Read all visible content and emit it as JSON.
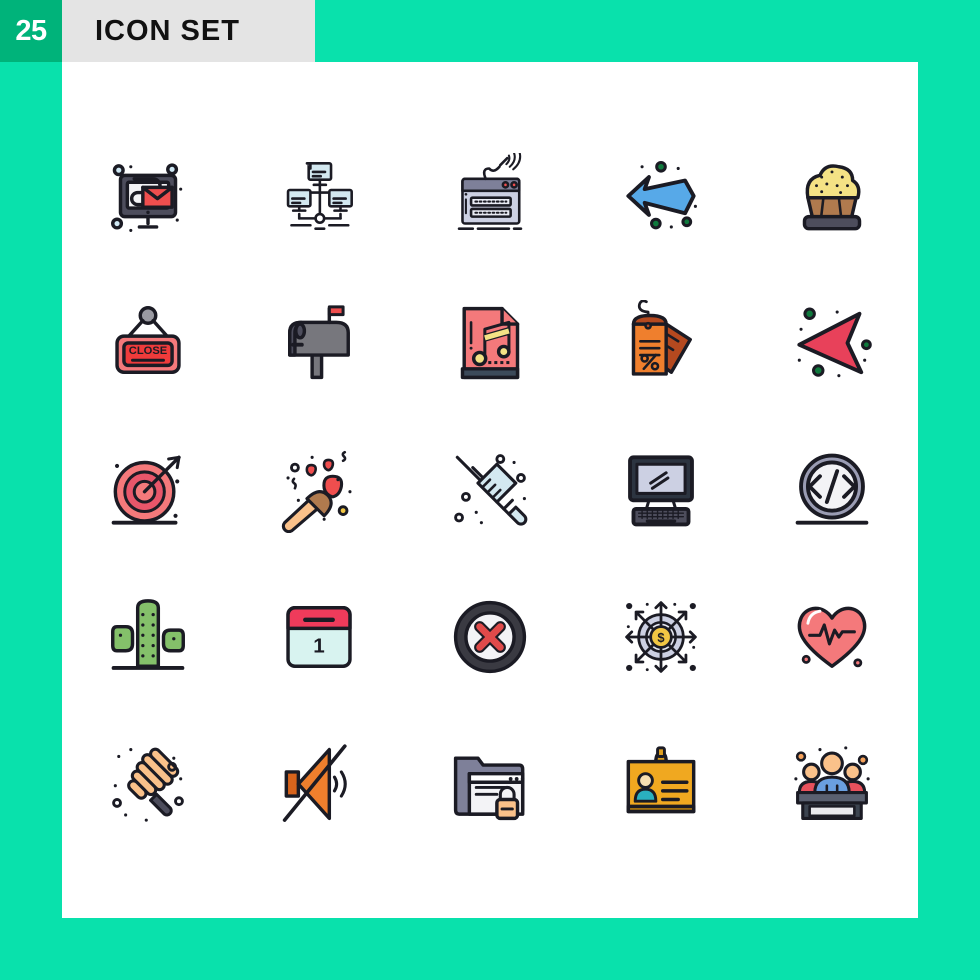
{
  "header": {
    "count": "25",
    "title": "ICON SET"
  },
  "colors": {
    "page_background": "#09e1ac",
    "header_background": "#e4e4e4",
    "badge_background": "#00b37a",
    "sheet_background": "#ffffff",
    "outline": "#1b1b24",
    "red": "#ef4e4e",
    "salmon": "#f4797b",
    "orange": "#ef7f2d",
    "peach": "#fac18a",
    "yellow": "#f4e285",
    "gold": "#f2c744",
    "green": "#84c06a",
    "dark_green": "#0f7a3d",
    "blue": "#57a9e8",
    "light_blue": "#d3e8f0",
    "lavender": "#ccd0e3",
    "slate": "#4d4d5c",
    "gray": "#77777d",
    "brown": "#b07a4e"
  },
  "grid": {
    "columns": 5,
    "rows": 5,
    "total": 25
  },
  "icons": [
    {
      "index": 1,
      "name": "email-monitor-icon",
      "label": "Email on monitor"
    },
    {
      "index": 2,
      "name": "computer-network-icon",
      "label": "Computer network"
    },
    {
      "index": 3,
      "name": "wireless-router-icon",
      "label": "Wireless router"
    },
    {
      "index": 4,
      "name": "right-arrow-icon",
      "label": "Right arrow"
    },
    {
      "index": 5,
      "name": "cupcake-icon",
      "label": "Cupcake"
    },
    {
      "index": 6,
      "name": "close-sign-icon",
      "label": "Close sign"
    },
    {
      "index": 7,
      "name": "mailbox-icon",
      "label": "Mailbox"
    },
    {
      "index": 8,
      "name": "music-file-icon",
      "label": "Music file"
    },
    {
      "index": 9,
      "name": "discount-tags-icon",
      "label": "Discount tags"
    },
    {
      "index": 10,
      "name": "left-arrow-cursor-icon",
      "label": "Left arrow cursor"
    },
    {
      "index": 11,
      "name": "target-arrow-icon",
      "label": "Target with arrow"
    },
    {
      "index": 12,
      "name": "makeup-brush-icon",
      "label": "Makeup brush"
    },
    {
      "index": 13,
      "name": "syringe-icon",
      "label": "Syringe"
    },
    {
      "index": 14,
      "name": "desktop-computer-icon",
      "label": "Desktop computer"
    },
    {
      "index": 15,
      "name": "code-circle-icon",
      "label": "Code circle"
    },
    {
      "index": 16,
      "name": "cactus-icon",
      "label": "Cactus"
    },
    {
      "index": 17,
      "name": "calendar-icon",
      "label": "Calendar",
      "day": "1"
    },
    {
      "index": 18,
      "name": "cancel-circle-icon",
      "label": "Cancel"
    },
    {
      "index": 19,
      "name": "money-network-icon",
      "label": "Money distribution"
    },
    {
      "index": 20,
      "name": "heartbeat-heart-icon",
      "label": "Heart with heartbeat"
    },
    {
      "index": 21,
      "name": "honey-dipper-icon",
      "label": "Honey dipper"
    },
    {
      "index": 22,
      "name": "mute-speaker-icon",
      "label": "Muted speaker"
    },
    {
      "index": 23,
      "name": "secure-folder-icon",
      "label": "Secure folder"
    },
    {
      "index": 24,
      "name": "id-card-icon",
      "label": "ID card"
    },
    {
      "index": 25,
      "name": "conference-panel-icon",
      "label": "Conference panel"
    }
  ],
  "close_sign": {
    "text": "CLOSE"
  },
  "discount_tag": {
    "symbol": "%"
  },
  "money_network": {
    "symbol": "$"
  },
  "code_circle": {
    "symbol": "</>"
  }
}
